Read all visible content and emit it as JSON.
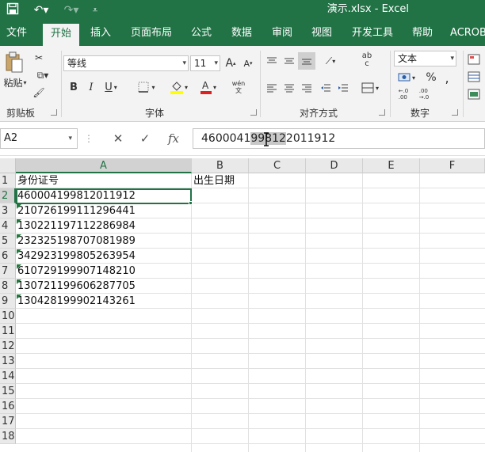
{
  "window": {
    "title": "演示.xlsx  -  Excel"
  },
  "tabs": [
    "文件",
    "开始",
    "插入",
    "页面布局",
    "公式",
    "数据",
    "审阅",
    "视图",
    "开发工具",
    "帮助",
    "ACROB"
  ],
  "ribbon": {
    "paste_label": "粘贴",
    "clipboard_label": "剪贴板",
    "font_name": "等线",
    "font_size": "11",
    "font_group_label": "字体",
    "align_group_label": "对齐方式",
    "number_format": "文本",
    "number_group_label": "数字",
    "bold": "B",
    "italic": "I",
    "underline": "U",
    "grow": "A",
    "shrink": "A",
    "percent": "%",
    "comma": ",",
    "dec_inc": "←.0\n.00",
    "dec_dec": ".00\n→.0",
    "abc": "ab\nc",
    "wen": "wén\n文"
  },
  "formula_bar": {
    "name_box": "A2",
    "formula_pre": "4600041",
    "formula_sel": "99812",
    "formula_post": "2011912"
  },
  "sheet": {
    "columns": [
      "A",
      "B",
      "C",
      "D",
      "E",
      "F"
    ],
    "active_column": "A",
    "active_row": 2,
    "rows": [
      "1",
      "2",
      "3",
      "4",
      "5",
      "6",
      "7",
      "8",
      "9",
      "10",
      "11",
      "12",
      "13",
      "14",
      "15",
      "16",
      "17",
      "18"
    ],
    "A": [
      "身份证号",
      "460004199812011912",
      "210726199111296441",
      "130221197112286984",
      "232325198707081989",
      "342923199805263954",
      "610729199907148210",
      "130721199606287705",
      "130428199902143261"
    ],
    "B1": "出生日期"
  },
  "colors": {
    "excel_green": "#217346"
  }
}
